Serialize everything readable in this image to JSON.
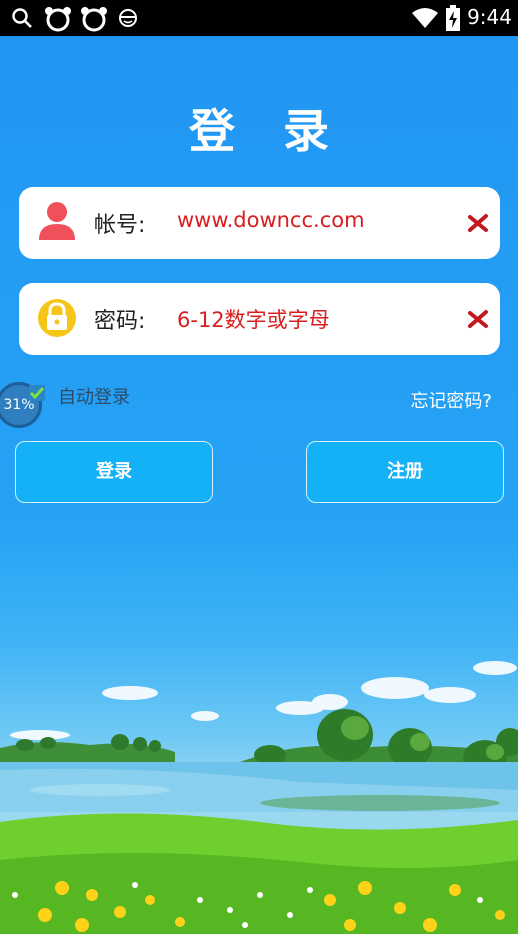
{
  "status_bar": {
    "time": "9:44",
    "icons": [
      "search-icon",
      "bear-face-icon",
      "bear-face-icon",
      "face-mask-icon",
      "wifi-icon",
      "battery-charging-icon"
    ]
  },
  "page": {
    "title": "登 录"
  },
  "account_field": {
    "label": "帐号:",
    "value": "www.downcc.com",
    "icon": "user-icon",
    "clear_icon": "clear-x-icon"
  },
  "password_field": {
    "label": "密码:",
    "value": "6-12数字或字母",
    "icon": "lock-icon",
    "clear_icon": "clear-x-icon"
  },
  "options": {
    "auto_login": "自动登录",
    "forgot_password": "忘记密码?",
    "overlay_progress": "31%"
  },
  "buttons": {
    "login": "登录",
    "register": "注册"
  },
  "colors": {
    "background": "#1e9bf0",
    "button": "#14b1f7",
    "input_text": "#d81e1e"
  }
}
